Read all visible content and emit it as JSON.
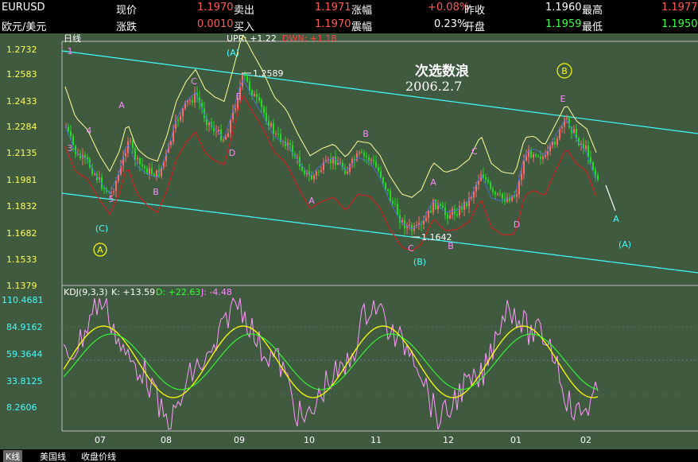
{
  "header": {
    "symbol": "EURUSD",
    "symbol_cn": "欧元/美元",
    "row1": [
      {
        "label": "现价",
        "value": "1.1970"
      },
      {
        "label": "卖出",
        "value": "1.1971"
      },
      {
        "label": "涨幅",
        "value": "+0.08%"
      },
      {
        "label": "昨收",
        "value": "1.1960"
      },
      {
        "label": "最高",
        "value": "1.1977"
      }
    ],
    "row2": [
      {
        "label": "涨跌",
        "value": "0.0010"
      },
      {
        "label": "买入",
        "value": "1.1970"
      },
      {
        "label": "震幅",
        "value": "0.23%"
      },
      {
        "label": "开盘",
        "value": "1.1959"
      },
      {
        "label": "最低",
        "value": "1.1950"
      }
    ]
  },
  "price_panel": {
    "period": "日线",
    "legend_upr": "UPR: +1.22",
    "legend_dwn": "DWN: +1.18",
    "title_text": "次选数浪",
    "date_text": "2006.2.7",
    "marker_high": "1.2589",
    "marker_low": "1.1642",
    "y_ticks": [
      "1.2732",
      "1.2583",
      "1.2433",
      "1.2284",
      "1.2135",
      "1.1981",
      "1.1832",
      "1.1682",
      "1.1533",
      "1.1379"
    ]
  },
  "kdj_panel": {
    "name": "KDJ(9,3,3)",
    "k_label": "K: +13.59",
    "d_label": "D: +22.63",
    "j_label": "J: -4.48",
    "y_ticks": [
      "110.4681",
      "84.9162",
      "59.3644",
      "33.8125",
      "8.2606"
    ]
  },
  "x_axis": [
    "07",
    "08",
    "09",
    "10",
    "11",
    "12",
    "01",
    "02"
  ],
  "bottom_tabs": [
    "K线",
    "美国线",
    "收盘价线"
  ],
  "wave_labels": [
    {
      "text": "1",
      "color": "#ff88ff"
    },
    {
      "text": "4",
      "color": "#ff88ff"
    },
    {
      "text": "3",
      "color": "#ff88ff"
    },
    {
      "text": "5",
      "color": "#ff88ff"
    },
    {
      "text": "A",
      "color": "#ff88ff"
    },
    {
      "text": "B",
      "color": "#ff88ff"
    },
    {
      "text": "C",
      "color": "#ff88ff"
    },
    {
      "text": "D",
      "color": "#ff88ff"
    },
    {
      "text": "E",
      "color": "#ff88ff"
    },
    {
      "text": "(A)",
      "color": "#40ffff"
    },
    {
      "text": "(C)",
      "color": "#40ffff"
    },
    {
      "text": "A",
      "color": "#ff88ff"
    },
    {
      "text": "B",
      "color": "#ff88ff"
    },
    {
      "text": "C",
      "color": "#ff88ff"
    },
    {
      "text": "A",
      "color": "#ff88ff"
    },
    {
      "text": "B",
      "color": "#ff88ff"
    },
    {
      "text": "C",
      "color": "#ff88ff"
    },
    {
      "text": "D",
      "color": "#ff88ff"
    },
    {
      "text": "E",
      "color": "#ff88ff"
    },
    {
      "text": "(B)",
      "color": "#40ffff"
    },
    {
      "text": "A",
      "color": "#40ffff"
    },
    {
      "text": "(A)",
      "color": "#40ffff"
    }
  ],
  "circled_labels": [
    "A",
    "B"
  ]
}
